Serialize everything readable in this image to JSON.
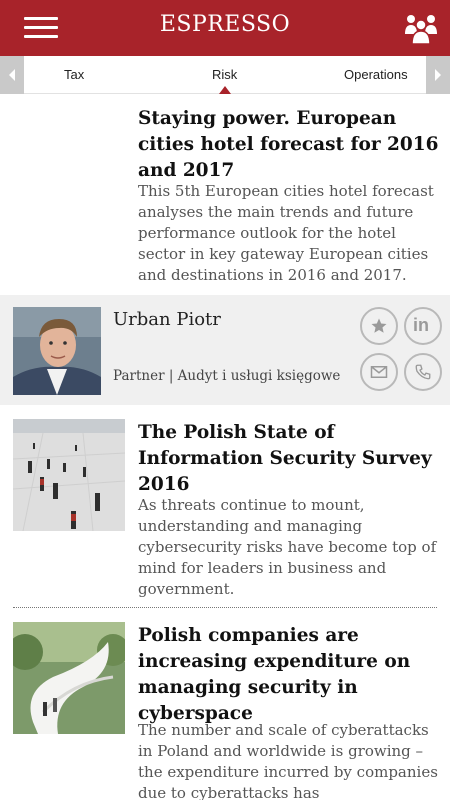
{
  "app": {
    "title": "ESPRESSO"
  },
  "tabs": {
    "left": "Tax",
    "active": "Risk",
    "right": "Operations"
  },
  "articles": [
    {
      "title": "Staying power. European cities hotel forecast for 2016 and 2017",
      "description": "This 5th European cities hotel forecast analyses the main trends and future performance outlook for the hotel sector in key gateway European cities and destinations in 2016 and 2017."
    },
    {
      "title": "The Polish State of Information Security Survey 2016",
      "description": "As threats continue to mount, understanding and managing cybersecurity risks have become top of mind for leaders in business and government."
    },
    {
      "title": "Polish companies are increasing expenditure on managing security in cyberspace",
      "description": "The number and scale of cyberattacks in Poland and worldwide is growing –the expenditure incurred by companies due to cyberattacks has"
    }
  ],
  "contact": {
    "name": "Urban Piotr",
    "role": "Partner | Audyt i usługi księgowe"
  },
  "icons": {
    "menu": "hamburger-menu-icon",
    "people": "people-group-icon",
    "star": "star-icon",
    "linkedin": "linkedin-icon",
    "mail": "envelope-icon",
    "phone": "phone-icon"
  },
  "colors": {
    "brand": "#a8232a",
    "contact_bg": "#f0f0f0",
    "tab_arrow": "#c9c9c9"
  }
}
